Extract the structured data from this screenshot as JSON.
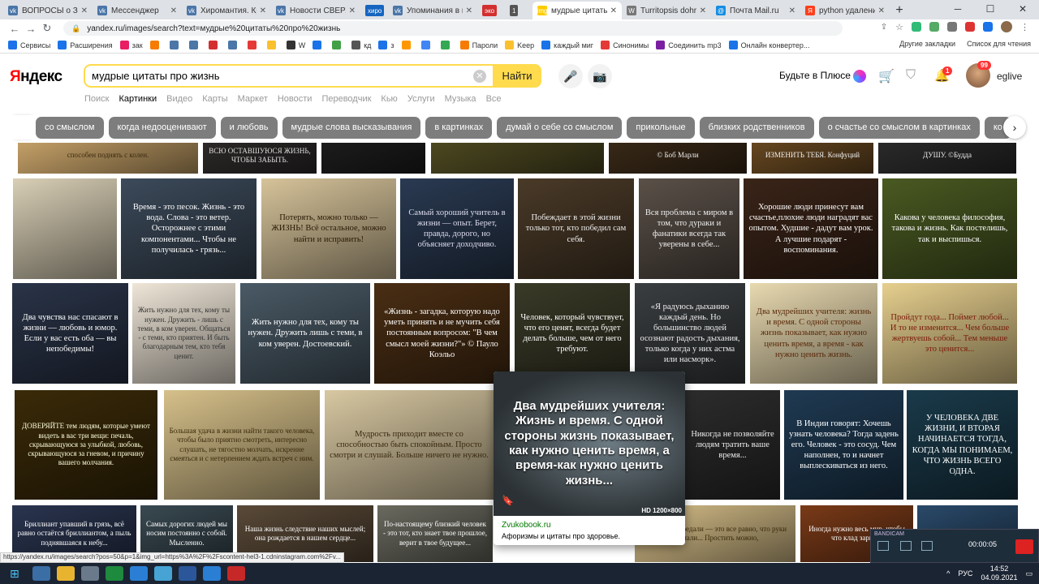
{
  "tabs": [
    {
      "title": "ВОПРОСЫ о Знак",
      "color": "#4a76a8",
      "glyph": "vk"
    },
    {
      "title": "Мессенджер",
      "color": "#4a76a8",
      "glyph": "vk"
    },
    {
      "title": "Хиромантия. Крис",
      "color": "#4a76a8",
      "glyph": "vk"
    },
    {
      "title": "Новости СВЕРХДЕ",
      "color": "#4a76a8",
      "glyph": "vk"
    },
    {
      "title": "хиро",
      "color": "#1565c0",
      "glyph": ""
    },
    {
      "title": "Упоминания в нов",
      "color": "#4a76a8",
      "glyph": "vk"
    },
    {
      "title": "эко",
      "color": "#d32f2f",
      "glyph": ""
    },
    {
      "title": "1",
      "color": "#555",
      "glyph": ""
    },
    {
      "title": "мудрые цитаты пр",
      "color": "#fc0",
      "glyph": "img",
      "active": true
    },
    {
      "title": "Turritopsis dohrni",
      "color": "#777",
      "glyph": "W"
    },
    {
      "title": "Почта Mail.ru",
      "color": "#168de2",
      "glyph": "@"
    },
    {
      "title": "python удаление",
      "color": "#fc3f1d",
      "glyph": "Я"
    }
  ],
  "address": {
    "url": "yandex.ru/images/search?text=мудрые%20цитаты%20про%20жизнь"
  },
  "bookmarks": [
    "Сервисы",
    "Расширения",
    "зак",
    "",
    "",
    "",
    "",
    "",
    "",
    "",
    "W",
    "",
    "",
    "кд",
    "з",
    "",
    "",
    "",
    "Пароли",
    "Keep",
    "каждый миг",
    "Синонимы",
    "Соединить mp3",
    "Онлайн конвертер..."
  ],
  "bookmarks_right": [
    "Другие закладки",
    "Список для чтения"
  ],
  "yandex": {
    "logo_a": "Я",
    "logo_b": "ндекс",
    "query": "мудрые цитаты про жизнь",
    "find": "Найти",
    "plus": "Будьте в Плюсе",
    "user": "eglive",
    "avatar_badge": "99",
    "bell_badge": "1"
  },
  "services": [
    "Поиск",
    "Картинки",
    "Видео",
    "Карты",
    "Маркет",
    "Новости",
    "Переводчик",
    "Кью",
    "Услуги",
    "Музыка",
    "Все"
  ],
  "chips": [
    "со смыслом",
    "когда недооценивают",
    "и любовь",
    "мудрые слова высказывания",
    "в картинках",
    "думай о себе со смыслом",
    "прикольные",
    "близких родственников",
    "о счастье со смыслом в картинках",
    "ко"
  ],
  "images": [
    {
      "text": "способен поднять с колен.",
      "bg": "#c9a46a",
      "fg": "#3a2a10"
    },
    {
      "text": "ВСЮ ОСТАВШУЮСЯ ЖИЗНЬ, ЧТОБЫ ЗАБЫТЬ.",
      "bg": "#2e2a2a",
      "fg": "#ddd"
    },
    {
      "text": "",
      "bg": "#1d1d1d",
      "fg": "#fff"
    },
    {
      "text": "",
      "bg": "#4e4a22",
      "fg": "#fff"
    },
    {
      "text": "",
      "bg": "#7a7560",
      "fg": "#fff"
    },
    {
      "text": "© Боб Марли",
      "bg": "#3a2a18",
      "fg": "#eee"
    },
    {
      "text": "ИЗМЕНИТЬ ТЕБЯ. Конфуций",
      "bg": "#6a4a22",
      "fg": "#eee"
    },
    {
      "text": "ДУШУ. ©Будда",
      "bg": "#2b2b2b",
      "fg": "#eee"
    },
    {
      "text": "",
      "bg": "#d9cfb6",
      "fg": "#444"
    },
    {
      "text": "Время - это песок. Жизнь - это вода. Слова - это ветер. Осторожнее с этими компонентами... Чтобы не получилась - грязь...",
      "bg": "#3c4a5a",
      "fg": "#fff"
    },
    {
      "text": "Потерять, можно только — ЖИЗНЬ! Всё остальное, можно найти и исправить!",
      "bg": "#d6c39a",
      "fg": "#2a1a05"
    },
    {
      "text": "Самый хороший учитель в жизни — опыт. Берет, правда, дорого, но объясняет доходчиво.",
      "bg": "#2a3a52",
      "fg": "#dde"
    },
    {
      "text": "Побеждает в этой жизни только тот, кто победил сам себя.",
      "bg": "#4a3a28",
      "fg": "#eee"
    },
    {
      "text": "Вся проблема с миром в том, что дураки и фанатики всегда так уверены в себе...",
      "bg": "#5a5048",
      "fg": "#eee"
    },
    {
      "text": "Хорошие люди принесут вам счастье,плохие люди наградят вас опытом. Худшие - дадут вам урок. А лучшие подарят - воспоминания.",
      "bg": "#3a2418",
      "fg": "#fff"
    },
    {
      "text": "Какова у человека философия, такова и жизнь. Как постелишь, так и выспишься.",
      "bg": "#4a5a22",
      "fg": "#fff"
    },
    {
      "text": "Два чувства нас спасают в жизни — любовь и юмор. Если у вас есть оба — вы непобедимы!",
      "bg": "#2a3448",
      "fg": "#fff"
    },
    {
      "text": "Жить нужно для тех, кому ты нужен. Дружить - лишь с теми, в ком уверен. Общаться - с теми, кто приятен. И быть благодарным тем, кто тебя ценит.",
      "bg": "#efe6d8",
      "fg": "#333"
    },
    {
      "text": "Жить нужно для тех, кому ты нужен. Дружить лишь с теми, в ком уверен. Достоевский.",
      "bg": "#4a5a66",
      "fg": "#fff"
    },
    {
      "text": "«Жизнь - загадка, которую надо уметь принять и не мучить себя постоянным вопросом: \"В чем смысл моей жизни?\"» © Пауло Коэльо",
      "bg": "#4a2e14",
      "fg": "#fff"
    },
    {
      "text": "Человек, который чувствует, что его ценят, всегда будет делать больше, чем от него требуют.",
      "bg": "#3a3a28",
      "fg": "#fff"
    },
    {
      "text": "«Я радуюсь дыханию каждый день. Но большинство людей осознают радость дыхания, только когда у них астма или насморк».",
      "bg": "#3a3e40",
      "fg": "#eee"
    },
    {
      "text": "Два мудрейших учителя: жизнь и время. С одной стороны жизнь показывает, как нужно ценить время, а время - как нужно ценить жизнь.",
      "bg": "#e8d9b0",
      "fg": "#5a2a0a"
    },
    {
      "text": "Пройдут года... Поймет любой... И то не изменится... Чем больше жертвуешь собой... Тем меньше это ценится...",
      "bg": "#e6cf8e",
      "fg": "#7a1a0a"
    },
    {
      "text": "ДОВЕРЯЙТЕ тем людям, которые умеют видеть в вас три вещи: печаль, скрывающуюся за улыбкой, любовь, скрывающуюся за гневом, и причину вашего молчания.",
      "bg": "#3a2a08",
      "fg": "#ffd"
    },
    {
      "text": "Большая удача в жизни найти такого человека, чтобы было приятно смотреть, интересно слушать, не тягостно молчать, искренне смеяться и с нетерпением ждать встреч с ним.",
      "bg": "#d6c08a",
      "fg": "#3a2a0a"
    },
    {
      "text": "Мудрость приходит вместе со способностью быть спокойным. Просто смотри и слушай. Больше ничего не нужно.",
      "bg": "#d8c8a2",
      "fg": "#3a2a10"
    },
    {
      "text": "Никогда не позволяйте людям тратить ваше время...",
      "bg": "#2c2c2c",
      "fg": "#eee"
    },
    {
      "text": "В Индии говорят: Хочешь узнать человека? Тогда задень его. Человек - это сосуд. Чем наполнен, то и начнет выплескиваться из него.",
      "bg": "#1f3a52",
      "fg": "#fff"
    },
    {
      "text": "У ЧЕЛОВЕКА ДВЕ ЖИЗНИ, И ВТОРАЯ НАЧИНАЕТСЯ ТОГДА, КОГДА МЫ ПОНИМАЕМ, ЧТО ЖИЗНЬ ВСЕГО ОДНА.",
      "bg": "#1a3a4a",
      "fg": "#fff"
    },
    {
      "text": "Бриллиант упавший в грязь, всё равно остаётся бриллиантом, а пыль поднявшаяся к небу...",
      "bg": "#2a3550",
      "fg": "#fff"
    },
    {
      "text": "Самых дорогих людей мы носим постоянно с собой. Мысленно.",
      "bg": "#3a4a52",
      "fg": "#fff"
    },
    {
      "text": "Наша жизнь следствие наших мыслей; она рождается в нашем сердце...",
      "bg": "#5a4a38",
      "fg": "#fff"
    },
    {
      "text": "По-настоящему близкий человек - это тот, кто знает твое прошлое, верит в твое будущее...",
      "bg": "#6a6a60",
      "fg": "#fff"
    },
    {
      "text": "Когда тебя предали — это все равно, что руки сломали... Простить можно,",
      "bg": "#d8c08a",
      "fg": "#3a2a0a"
    },
    {
      "text": "Иногда нужно весь мир, чтобы что клад зарыт...",
      "bg": "#7a3a18",
      "fg": "#fff"
    },
    {
      "text": "",
      "bg": "#2a4a6a",
      "fg": "#fff"
    }
  ],
  "hover": {
    "text": "Два мудрейших учителя: Жизнь и время. С одной стороны жизнь показывает, как нужно ценить время, а время-как нужно ценить жизнь...",
    "hd": "HD 1200×800",
    "source": "Zvukobook.ru",
    "desc": "Афоризмы и цитаты про здоровье."
  },
  "status_url": "https://yandex.ru/images/search?pos=50&p=1&img_url=https%3A%2F%2Fscontent-hel3-1.cdninstagram.com%2Fv...",
  "recorder": {
    "title": "BANDICAM",
    "time": "00:00:05"
  },
  "taskbar": {
    "lang": "РУС",
    "time": "14:52",
    "date": "04.09.2021"
  }
}
